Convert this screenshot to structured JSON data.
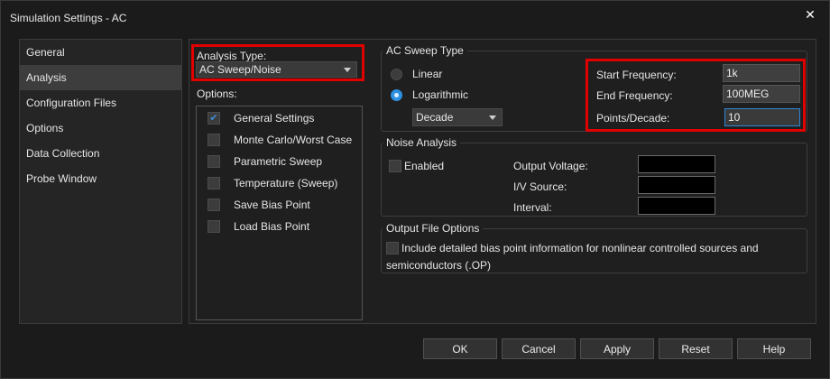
{
  "window": {
    "title": "Simulation Settings - AC",
    "close_glyph": "✕"
  },
  "nav": {
    "items": [
      {
        "label": "General",
        "active": false
      },
      {
        "label": "Analysis",
        "active": true
      },
      {
        "label": "Configuration Files",
        "active": false
      },
      {
        "label": "Options",
        "active": false
      },
      {
        "label": "Data Collection",
        "active": false
      },
      {
        "label": "Probe Window",
        "active": false
      }
    ]
  },
  "analysis": {
    "type_label": "Analysis Type:",
    "type_value": "AC Sweep/Noise",
    "options_label": "Options:",
    "options": [
      {
        "label": "General Settings",
        "checked": true
      },
      {
        "label": "Monte Carlo/Worst Case",
        "checked": false
      },
      {
        "label": "Parametric Sweep",
        "checked": false
      },
      {
        "label": "Temperature (Sweep)",
        "checked": false
      },
      {
        "label": "Save Bias Point",
        "checked": false
      },
      {
        "label": "Load Bias Point",
        "checked": false
      }
    ]
  },
  "ac_sweep": {
    "group_title": "AC Sweep Type",
    "linear_label": "Linear",
    "log_label": "Logarithmic",
    "selected": "Logarithmic",
    "decade_value": "Decade",
    "start_freq_label": "Start Frequency:",
    "start_freq_value": "1k",
    "end_freq_label": "End Frequency:",
    "end_freq_value": "100MEG",
    "points_label": "Points/Decade:",
    "points_value": "10"
  },
  "noise": {
    "group_title": "Noise Analysis",
    "enabled_label": "Enabled",
    "enabled": false,
    "output_voltage_label": "Output Voltage:",
    "iv_source_label": "I/V Source:",
    "interval_label": "Interval:",
    "output_voltage_value": "",
    "iv_source_value": "",
    "interval_value": ""
  },
  "output_file": {
    "group_title": "Output File Options",
    "detail_line1": "Include detailed bias point information for nonlinear controlled sources and",
    "detail_line2": "semiconductors (.OP)",
    "checked": false
  },
  "buttons": {
    "ok": "OK",
    "cancel": "Cancel",
    "apply": "Apply",
    "reset": "Reset",
    "help": "Help"
  },
  "colors": {
    "highlight": "#e00000",
    "accent": "#2e90e0",
    "background": "#1b1b1b"
  }
}
